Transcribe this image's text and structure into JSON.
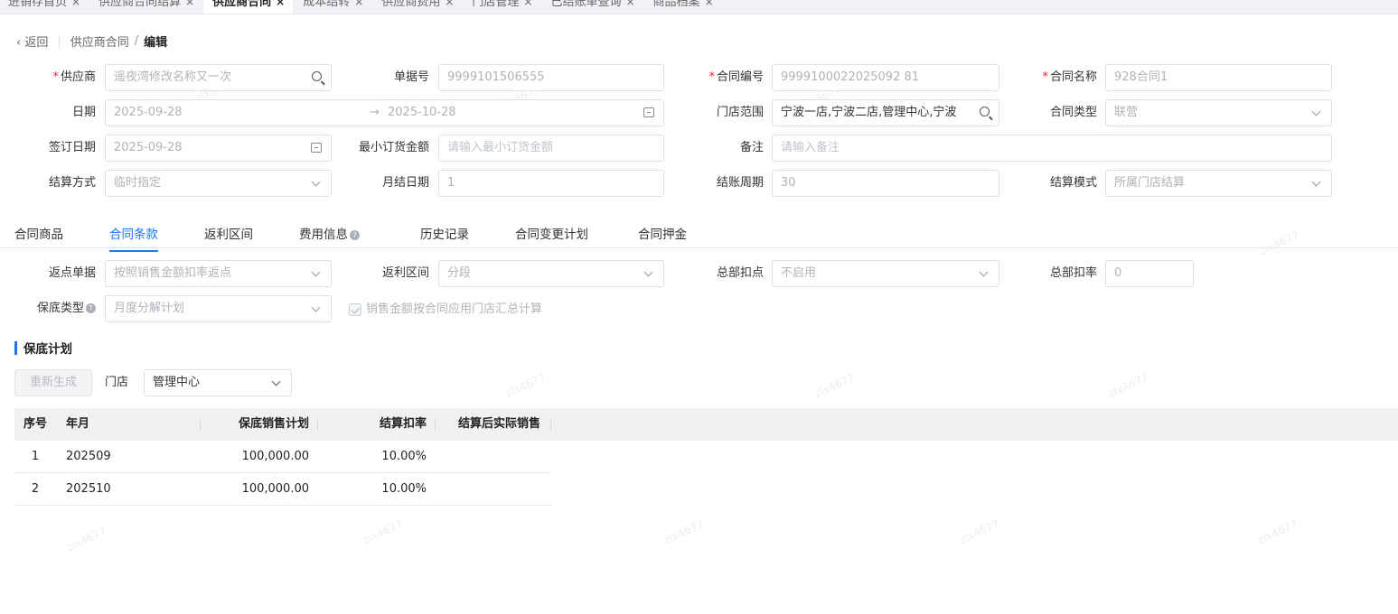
{
  "page_tabs": [
    {
      "label": "进销存首页"
    },
    {
      "label": "供应商合同结算"
    },
    {
      "label": "供应商合同"
    },
    {
      "label": "成本结转"
    },
    {
      "label": "供应商费用"
    },
    {
      "label": "门店管理"
    },
    {
      "label": "已结账单查询"
    },
    {
      "label": "商品档案"
    }
  ],
  "active_tab_index": 2,
  "close_glyph": "×",
  "breadcrumb": {
    "back": "返回",
    "parent": "供应商合同",
    "current": "编辑"
  },
  "form": {
    "supplier": {
      "label": "供应商",
      "value": "遥夜湾修改名称又一次",
      "required": true
    },
    "doc_no": {
      "label": "单据号",
      "value": "9999101506555"
    },
    "contract_no": {
      "label": "合同编号",
      "value": "9999100022025092 81",
      "required": true
    },
    "contract_name": {
      "label": "合同名称",
      "value": "928合同1",
      "required": true
    },
    "date": {
      "label": "日期",
      "start": "2025-09-28",
      "arrow": "→",
      "end": "2025-10-28"
    },
    "store_scope": {
      "label": "门店范围",
      "value": "宁波一店,宁波二店,管理中心,宁波"
    },
    "contract_type": {
      "label": "合同类型",
      "value": "联营"
    },
    "sign_date": {
      "label": "签订日期",
      "value": "2025-09-28"
    },
    "min_order": {
      "label": "最小订货金额",
      "placeholder": "请输入最小订货金额"
    },
    "remark": {
      "label": "备注",
      "placeholder": "请输入备注"
    },
    "settle_method": {
      "label": "结算方式",
      "value": "临时指定"
    },
    "monthly_date": {
      "label": "月结日期",
      "value": "1"
    },
    "billing_cycle": {
      "label": "结账周期",
      "value": "30"
    },
    "settle_mode": {
      "label": "结算模式",
      "value": "所属门店结算"
    }
  },
  "sub_tabs": [
    {
      "label": "合同商品"
    },
    {
      "label": "合同条款"
    },
    {
      "label": "返利区间"
    },
    {
      "label": "费用信息",
      "help": true
    },
    {
      "label": "历史记录"
    },
    {
      "label": "合同变更计划"
    },
    {
      "label": "合同押金"
    }
  ],
  "active_sub_tab_index": 1,
  "terms": {
    "rebate_basis": {
      "label": "返点单据",
      "value": "按照销售金额扣率返点"
    },
    "rebate_range": {
      "label": "返利区间",
      "value": "分段"
    },
    "hq_point": {
      "label": "总部扣点",
      "value": "不启用"
    },
    "hq_rate": {
      "label": "总部扣率",
      "value": "0"
    },
    "guarantee_type": {
      "label": "保底类型",
      "value": "月度分解计划"
    },
    "aggregate_checkbox": {
      "label": "销售金额按合同应用门店汇总计算",
      "checked": true
    }
  },
  "plan": {
    "section_title": "保底计划",
    "regenerate_label": "重新生成",
    "store_label": "门店",
    "store_value": "管理中心",
    "columns": [
      "序号",
      "年月",
      "保底销售计划",
      "结算扣率",
      "结算后实际销售"
    ],
    "rows": [
      {
        "no": "1",
        "ym": "202509",
        "plan": "100,000.00",
        "rate": "10.00%",
        "actual": ""
      },
      {
        "no": "2",
        "ym": "202510",
        "plan": "100,000.00",
        "rate": "10.00%",
        "actual": ""
      }
    ]
  },
  "watermark_text": "zlx4677",
  "colors": {
    "accent": "#1677ff",
    "required": "#f5222d"
  }
}
